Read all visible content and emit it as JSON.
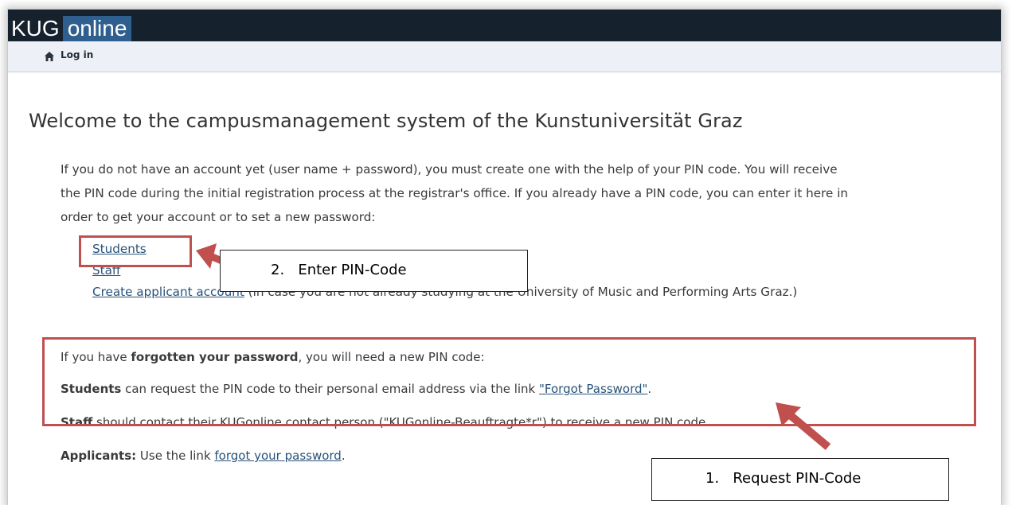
{
  "header": {
    "logo_part1": "KUG",
    "logo_part2": "online"
  },
  "breadcrumb": {
    "icon": "home-icon",
    "label": "Log in"
  },
  "main": {
    "title": "Welcome to the campusmanagement system of the Kunstuniversität Graz",
    "intro_line1": "If you do not have an account yet (user name + password), you must create one with the help of your PIN code. You will receive",
    "intro_line2": "the PIN code during the initial registration process at the registrar's office. If you already have a PIN code, you can enter it here in",
    "intro_line3": "order to get your account or to set a new password:",
    "links": {
      "students": "Students",
      "staff": "Staff",
      "create_applicant": "Create applicant account",
      "create_applicant_note": "(in case you are not already studying at the University of Music and Performing Arts Graz.)"
    },
    "forgot": {
      "line1_prefix": "If you have ",
      "line1_bold": "forgotten your password",
      "line1_suffix": ", you will need a new PIN code:",
      "students_bold": "Students",
      "students_text": " can request the PIN code to their personal email address via the link ",
      "students_link": "\"Forgot Password\"",
      "students_end": ".",
      "staff_bold": "Staff",
      "staff_text": " should contact their KUGonline contact person (\"KUGonline-Beauftragte*r\") to receive a new PIN code.",
      "applicants_bold": "Applicants:",
      "applicants_text": " Use the link ",
      "applicants_link": "forgot your password",
      "applicants_end": "."
    }
  },
  "annotations": {
    "callout_enter": "2.   Enter PIN-Code",
    "callout_request": "1.   Request PIN-Code",
    "highlight_color": "#c0504d"
  }
}
